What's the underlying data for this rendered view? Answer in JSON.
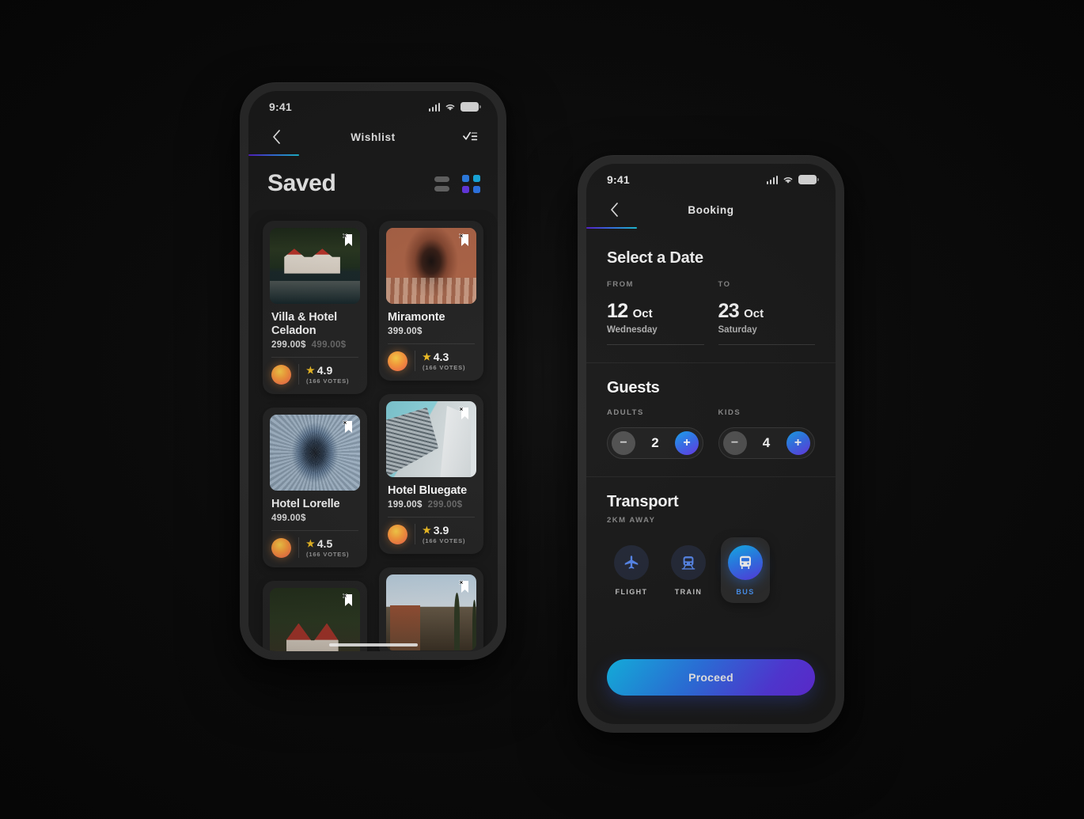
{
  "wishlist": {
    "status_bar": {
      "time": "9:41"
    },
    "nav": {
      "back_icon": "chevron-left-icon",
      "title": "Wishlist",
      "filter_icon": "checklist-icon"
    },
    "page_title": "Saved",
    "view_toggle": {
      "list_icon": "list-view-icon",
      "grid_icon": "grid-view-icon",
      "active": "grid"
    },
    "cards": [
      {
        "name": "Villa & Hotel Celadon",
        "price": "299.00$",
        "price_old": "499.00$",
        "rating": "4.9",
        "votes": "(166 VOTES)",
        "image": "lake-house-photo",
        "bookmark_icon": "bookmark-remove-icon"
      },
      {
        "name": "Miramonte",
        "price": "399.00$",
        "price_old": "",
        "rating": "4.3",
        "votes": "(166 VOTES)",
        "image": "archway-corridor-photo",
        "bookmark_icon": "bookmark-remove-icon"
      },
      {
        "name": "Hotel Lorelle",
        "price": "499.00$",
        "price_old": "",
        "rating": "4.5",
        "votes": "(166 VOTES)",
        "image": "vaulted-hall-photo",
        "bookmark_icon": "bookmark-remove-icon"
      },
      {
        "name": "Hotel Bluegate",
        "price": "199.00$",
        "price_old": "299.00$",
        "rating": "3.9",
        "votes": "(166 VOTES)",
        "image": "modern-tower-photo",
        "bookmark_icon": "bookmark-remove-icon"
      },
      {
        "name": "",
        "price": "",
        "price_old": "",
        "rating": "",
        "votes": "",
        "image": "forest-cabin-photo",
        "bookmark_icon": "bookmark-remove-icon"
      },
      {
        "name": "",
        "price": "",
        "price_old": "",
        "rating": "",
        "votes": "",
        "image": "desert-ruin-photo",
        "bookmark_icon": "bookmark-remove-icon"
      }
    ]
  },
  "booking": {
    "status_bar": {
      "time": "9:41"
    },
    "nav": {
      "back_icon": "chevron-left-icon",
      "title": "Booking"
    },
    "date": {
      "heading": "Select a Date",
      "from_label": "FROM",
      "to_label": "TO",
      "from_day": "12",
      "from_month": "Oct",
      "from_weekday": "Wednesday",
      "to_day": "23",
      "to_month": "Oct",
      "to_weekday": "Saturday"
    },
    "guests": {
      "heading": "Guests",
      "adults_label": "ADULTS",
      "adults_value": "2",
      "kids_label": "KIDS",
      "kids_value": "4",
      "minus": "−",
      "plus": "+"
    },
    "transport": {
      "heading": "Transport",
      "subtitle": "2KM AWAY",
      "options": [
        {
          "label": "FLIGHT",
          "icon": "airplane-icon",
          "active": false
        },
        {
          "label": "TRAIN",
          "icon": "train-icon",
          "active": false
        },
        {
          "label": "BUS",
          "icon": "bus-icon",
          "active": true
        }
      ]
    },
    "proceed_label": "Proceed"
  },
  "colors": {
    "accent_blue": "#2f7cf5",
    "accent_cyan": "#14c3f7",
    "accent_purple": "#5b3ef2",
    "star_yellow": "#f7c325",
    "background": "#0c0c0c",
    "frame": "#2d2d2d",
    "screen": "#1c1c1c",
    "card": "#252525"
  }
}
